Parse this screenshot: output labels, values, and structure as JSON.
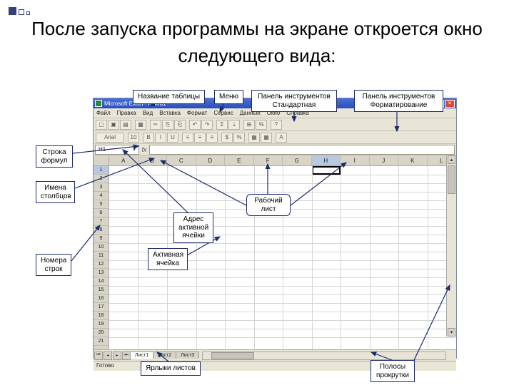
{
  "heading": "После запуска программы на экране откроется окно следующего вида:",
  "excel": {
    "title": "Microsoft Excel - Книга1",
    "menu": [
      "Файл",
      "Правка",
      "Вид",
      "Вставка",
      "Формат",
      "Сервис",
      "Данные",
      "Окно",
      "Справка"
    ],
    "namebox": "H1",
    "columns": [
      "A",
      "B",
      "C",
      "D",
      "E",
      "F",
      "G",
      "H",
      "I",
      "J",
      "K",
      "L"
    ],
    "rows": [
      "1",
      "2",
      "3",
      "4",
      "5",
      "6",
      "7",
      "8",
      "9",
      "10",
      "11",
      "12",
      "13",
      "14",
      "15",
      "16",
      "17",
      "18",
      "19",
      "20",
      "21"
    ],
    "sheets": [
      "Лист1",
      "Лист2",
      "Лист3"
    ],
    "status": "Готово",
    "active_col_index": 7,
    "active_row_index": 0,
    "winbtns": {
      "min": "_",
      "max": "□",
      "close": "×"
    }
  },
  "callouts": {
    "title_label": "Название таблицы",
    "menu_label": "Меню",
    "toolbar_std": "Панель инструментов Стандартная",
    "toolbar_fmt": "Панель инструментов Форматирование",
    "formula_row": "Строка формул",
    "col_names": "Имена столбцов",
    "row_numbers": "Номера строк",
    "cell_addr": "Адрес активной ячейки",
    "active_cell": "Активная ячейка",
    "worksheet": "Рабочий лист",
    "sheet_tabs": "Ярлыки листов",
    "scrollbars": "Полосы прокрутки"
  }
}
